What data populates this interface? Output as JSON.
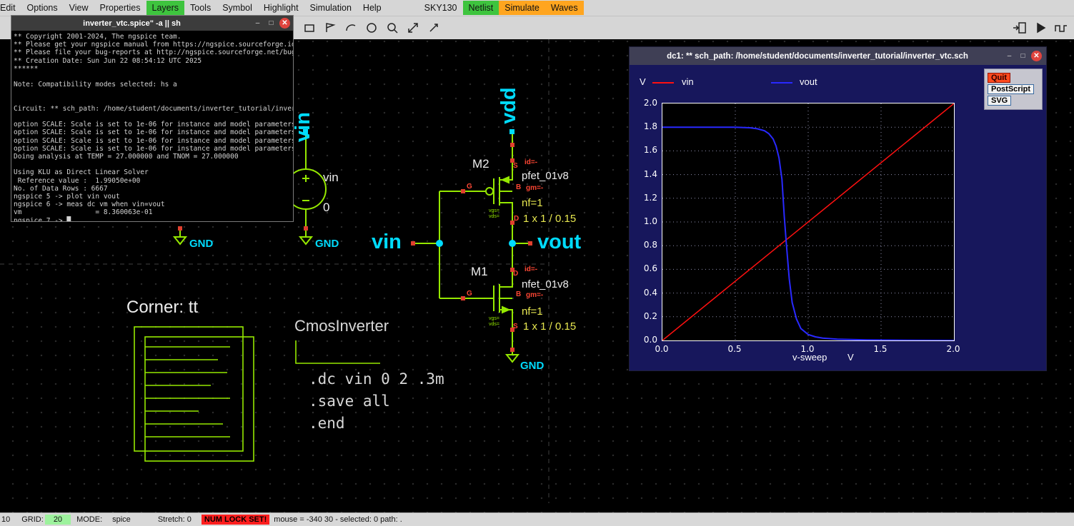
{
  "menubar": {
    "items": [
      "Edit",
      "Options",
      "View",
      "Properties",
      "Layers",
      "Tools",
      "Symbol",
      "Highlight",
      "Simulation",
      "Help"
    ],
    "sky130": "SKY130",
    "netlist": "Netlist",
    "simulate": "Simulate",
    "waves": "Waves"
  },
  "toolbar": {
    "left_icons": [
      "rectangle-tool",
      "polygon-tool",
      "arc-tool",
      "circle-tool",
      "zoom-tool",
      "zoom-full-tool",
      "pan-tool"
    ],
    "right_icons": [
      "netlist-export",
      "run-simulation",
      "view-waves"
    ]
  },
  "terminal": {
    "title": "inverter_vtc.spice\" -a || sh",
    "controls": {
      "minimize": "–",
      "maximize": "□",
      "close": "✕"
    },
    "text": "** Copyright 2001-2024, The ngspice team.\n** Please get your ngspice manual from https://ngspice.sourceforge.io/docs.html\n** Please file your bug-reports at http://ngspice.sourceforge.net/bugrep.html\n** Creation Date: Sun Jun 22 08:54:12 UTC 2025\n******\n\nNote: Compatibility modes selected: hs a\n\n\nCircuit: ** sch_path: /home/student/documents/inverter_tutorial/inverter_vtc.sch\n\noption SCALE: Scale is set to 1e-06 for instance and model parameters\noption SCALE: Scale is set to 1e-06 for instance and model parameters\noption SCALE: Scale is set to 1e-06 for instance and model parameters\noption SCALE: Scale is set to 1e-06 for instance and model parameters\nDoing analysis at TEMP = 27.000000 and TNOM = 27.000000\n\nUsing KLU as Direct Linear Solver\n Reference value :  1.99050e+00\nNo. of Data Rows : 6667\nngspice 5 -> plot vin vout\nngspice 6 -> meas dc vm when vin=vout\nvm                  = 8.360063e-01\nngspice 7 -> █"
  },
  "schematic": {
    "vdd_label": "vdd",
    "vin_net_label": "vin",
    "vin_input_label": "vin",
    "vout_label": "vout",
    "gnd_label": "GND",
    "source_name": "vin",
    "source_value": "0",
    "m2": {
      "name": "M2",
      "model": "pfet_01v8",
      "nf": "nf=1",
      "size": "1 x 1 / 0.15",
      "id": "id=-",
      "gm": "gm=-"
    },
    "m1": {
      "name": "M1",
      "model": "nfet_01v8",
      "nf": "nf=1",
      "size": "1 x 1 / 0.15",
      "id": "id=-",
      "gm": "gm=-"
    },
    "pins": {
      "g": "G",
      "d": "D",
      "s": "S",
      "b": "B"
    },
    "vgs_vds": "vgs=\nvds=",
    "corner_label": "Corner: tt",
    "cell_name": "CmosInverter",
    "spice_directives": ".dc vin 0 2 .3m\n.save all\n.end"
  },
  "plot_window": {
    "title": "dc1: ** sch_path: /home/student/documents/inverter_tutorial/inverter_vtc.sch",
    "controls": {
      "minimize": "–",
      "maximize": "□",
      "close": "✕"
    },
    "y_axis_unit": "V",
    "x_axis_unit": "V",
    "buttons": [
      "Quit",
      "PostScript",
      "SVG"
    ]
  },
  "chart_data": {
    "type": "line",
    "title": "",
    "xlabel": "v-sweep",
    "ylabel": "V",
    "xlim": [
      0,
      2
    ],
    "ylim": [
      0,
      2
    ],
    "x_ticks": [
      0,
      0.5,
      1,
      1.5,
      2
    ],
    "y_ticks": [
      0,
      0.2,
      0.4,
      0.6,
      0.8,
      1,
      1.2,
      1.4,
      1.6,
      1.8,
      2
    ],
    "grid": true,
    "legend_position": "top",
    "series": [
      {
        "name": "vin",
        "color": "#ff1010",
        "points": [
          [
            0,
            0
          ],
          [
            2,
            2
          ]
        ]
      },
      {
        "name": "vout",
        "color": "#2929ff",
        "points": [
          [
            0,
            1.8
          ],
          [
            0.3,
            1.8
          ],
          [
            0.5,
            1.8
          ],
          [
            0.6,
            1.795
          ],
          [
            0.65,
            1.787
          ],
          [
            0.7,
            1.77
          ],
          [
            0.73,
            1.745
          ],
          [
            0.76,
            1.7
          ],
          [
            0.78,
            1.64
          ],
          [
            0.8,
            1.54
          ],
          [
            0.82,
            1.36
          ],
          [
            0.836,
            1.05
          ],
          [
            0.85,
            0.82
          ],
          [
            0.87,
            0.52
          ],
          [
            0.89,
            0.32
          ],
          [
            0.92,
            0.18
          ],
          [
            0.95,
            0.1
          ],
          [
            1,
            0.05
          ],
          [
            1.05,
            0.03
          ],
          [
            1.1,
            0.02
          ],
          [
            1.2,
            0.01
          ],
          [
            1.4,
            0.004
          ],
          [
            1.7,
            0.001
          ],
          [
            2,
            0
          ]
        ]
      }
    ]
  },
  "statusbar": {
    "scale": "10",
    "grid_label": "GRID:",
    "grid_value": "20",
    "mode_label": "MODE:",
    "mode_value": "spice",
    "stretch": "Stretch: 0",
    "numlock": "NUM LOCK SET!",
    "mouse_info": "mouse = -340 30 - selected: 0 path: ."
  }
}
